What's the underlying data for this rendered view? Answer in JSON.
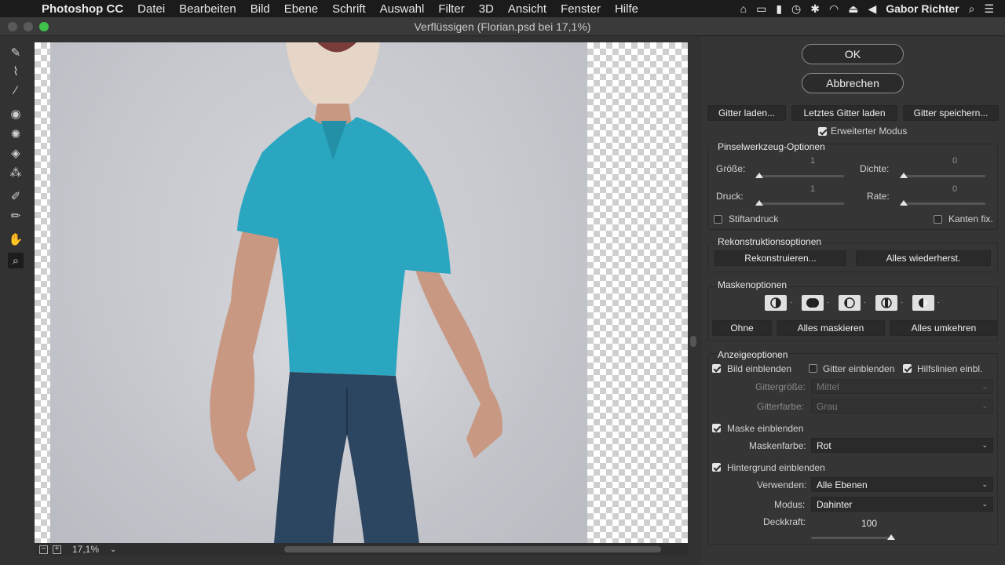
{
  "menubar": {
    "apple_icon": "apple-icon",
    "app": "Photoshop CC",
    "menus": [
      "Datei",
      "Bearbeiten",
      "Bild",
      "Ebene",
      "Schrift",
      "Auswahl",
      "Filter",
      "3D",
      "Ansicht",
      "Fenster",
      "Hilfe"
    ],
    "user": "Gabor Richter"
  },
  "window": {
    "title": "Verflüssigen (Florian.psd bei 17,1%)"
  },
  "canvas": {
    "zoom": "17,1%"
  },
  "buttons": {
    "ok": "OK",
    "cancel": "Abbrechen"
  },
  "mesh": {
    "load": "Gitter laden...",
    "load_last": "Letztes Gitter laden",
    "save": "Gitter speichern...",
    "advanced_mode": "Erweiterter Modus",
    "advanced_checked": true
  },
  "brush": {
    "title": "Pinselwerkzeug-Optionen",
    "size_label": "Größe:",
    "size_value": "1",
    "density_label": "Dichte:",
    "density_value": "0",
    "pressure_label": "Druck:",
    "pressure_value": "1",
    "rate_label": "Rate:",
    "rate_value": "0",
    "stylus_label": "Stiftandruck",
    "pin_edges_label": "Kanten fix."
  },
  "reconstruct": {
    "title": "Rekonstruktionsoptionen",
    "reconstruct": "Rekonstruieren...",
    "restore_all": "Alles wiederherst."
  },
  "mask": {
    "title": "Maskenoptionen",
    "none": "Ohne",
    "mask_all": "Alles maskieren",
    "invert_all": "Alles umkehren"
  },
  "view": {
    "title": "Anzeigeoptionen",
    "show_image": "Bild einblenden",
    "show_image_checked": true,
    "show_mesh": "Gitter einblenden",
    "show_mesh_checked": false,
    "show_guides": "Hilfslinien einbl.",
    "show_guides_checked": true,
    "mesh_size_label": "Gittergröße:",
    "mesh_size_value": "Mittel",
    "mesh_color_label": "Gitterfarbe:",
    "mesh_color_value": "Grau",
    "show_mask": "Maske einblenden",
    "show_mask_checked": true,
    "mask_color_label": "Maskenfarbe:",
    "mask_color_value": "Rot",
    "show_backdrop": "Hintergrund einblenden",
    "show_backdrop_checked": true,
    "use_label": "Verwenden:",
    "use_value": "Alle Ebenen",
    "mode_label": "Modus:",
    "mode_value": "Dahinter",
    "opacity_label": "Deckkraft:",
    "opacity_value": "100"
  },
  "colors": {
    "shirt": "#2aa6c0",
    "jeans": "#2c4560",
    "skin": "#c99883",
    "background": "#c8cad0",
    "panel": "#353535"
  }
}
